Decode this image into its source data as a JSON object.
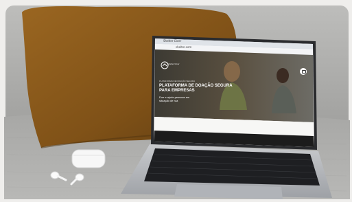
{
  "scene": {
    "description_free": true
  },
  "browser": {
    "tab_title": "Shelter Giver",
    "url": "shelter.com"
  },
  "website": {
    "logo_text": "Shelter Giver",
    "eyebrow": "PLATAFORMA DE DOAÇÃO SEGURA",
    "headline_line1": "PLATAFORMA DE DOAÇÃO SEGURA",
    "headline_line2": "PARA EMPRESAS",
    "subtext_line1": "Doe e ajude pessoas em",
    "subtext_line2": "situação de rua"
  },
  "colors": {
    "pillow": "#8a5a1c",
    "sofa": "#a9a9a7",
    "laptop_body": "#b9bcc0",
    "keyboard": "#1e1f22"
  }
}
